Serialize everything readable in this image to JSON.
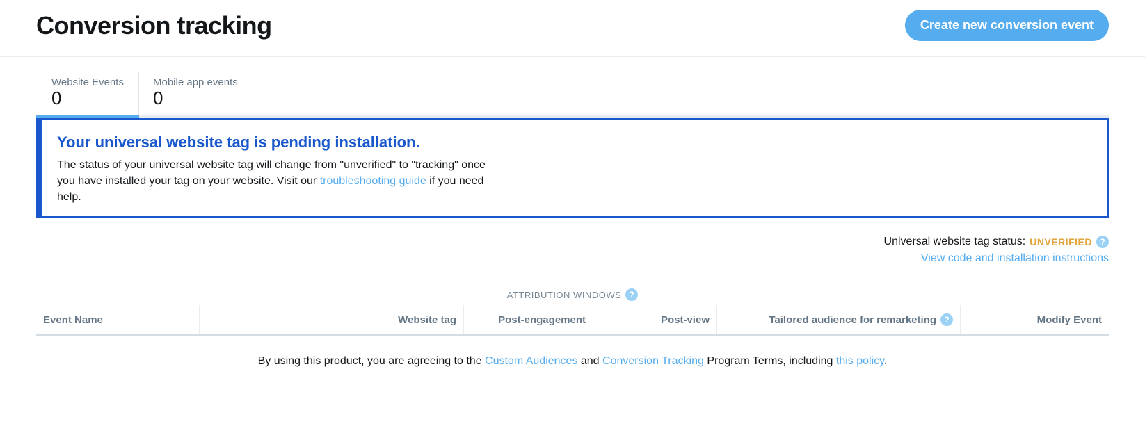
{
  "header": {
    "title": "Conversion tracking",
    "create_btn": "Create new conversion event"
  },
  "tabs": {
    "website": {
      "label": "Website Events",
      "count": "0"
    },
    "mobile": {
      "label": "Mobile app events",
      "count": "0"
    }
  },
  "alert": {
    "title": "Your universal website tag is pending installation.",
    "body_prefix": "The status of your universal website tag will change from \"unverified\" to \"tracking\" once you have installed your tag on your website. Visit our ",
    "link_text": "troubleshooting guide",
    "body_suffix": " if you need help."
  },
  "status": {
    "label": "Universal website tag status:",
    "value": "UNVERIFIED",
    "view_code": "View code and installation instructions"
  },
  "attribution": {
    "heading": "ATTRIBUTION WINDOWS"
  },
  "table": {
    "cols": {
      "event": "Event Name",
      "website": "Website tag",
      "post_engage": "Post-engagement",
      "post_view": "Post-view",
      "tailored": "Tailored audience for remarketing",
      "modify": "Modify Event"
    }
  },
  "footer": {
    "prefix": "By using this product, you are agreeing to the ",
    "link1": "Custom Audiences",
    "mid1": " and ",
    "link2": "Conversion Tracking",
    "mid2": " Program Terms, including ",
    "link3": "this policy",
    "suffix": "."
  },
  "help_glyph": "?"
}
